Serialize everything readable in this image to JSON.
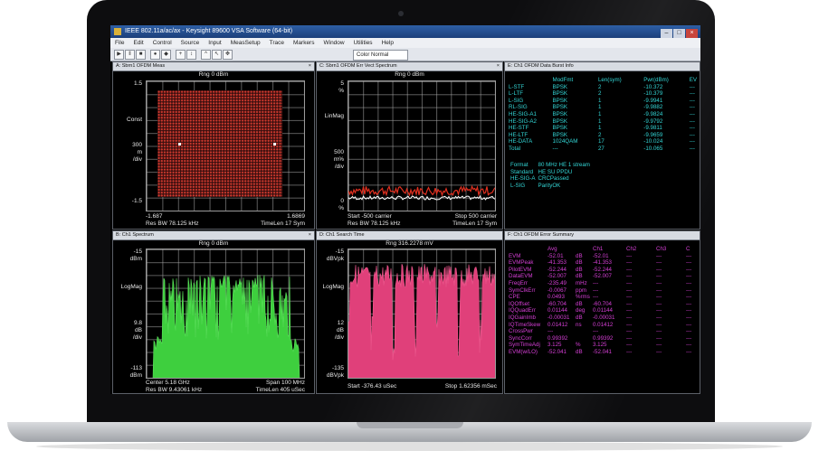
{
  "window": {
    "title": "IEEE 802.11a/ac/ax - Keysight 89600 VSA Software (64-bit)",
    "buttons": [
      "–",
      "□",
      "×"
    ]
  },
  "menu": [
    "File",
    "Edit",
    "Control",
    "Source",
    "Input",
    "MeasSetup",
    "Trace",
    "Markers",
    "Window",
    "Utilities",
    "Help"
  ],
  "toolbar": {
    "color_mode": "Color Normal",
    "icons": [
      "play-icon",
      "pause-icon",
      "stop-icon",
      "record-icon",
      "marker-icon",
      "zoom-icon",
      "cursor-icon",
      "pan-icon",
      "autoscale-icon",
      "peak-icon"
    ]
  },
  "colors": {
    "trace_white": "#ffffff",
    "trace_red": "#e03020",
    "trace_green": "#3ecf3e",
    "trace_pink": "#e0407a",
    "text_cyan": "#33d6d6",
    "text_magenta": "#d63fd6"
  },
  "panels": {
    "a": {
      "tab": "A: Sbrn1 OFDM Meas",
      "ref": "Rng 0 dBm",
      "y_labels": [
        "1.5",
        "Const",
        "300",
        "m",
        "/div",
        "-1.5"
      ],
      "footer_left": "-1.687",
      "footer_right": "1.6869",
      "footer2_left": "Res BW 78.125 kHz",
      "footer2_right": "TimeLen 17  Sym"
    },
    "b": {
      "tab": "B: Ch1 Spectrum",
      "ref": "Rng 0 dBm",
      "y_labels": [
        "-15",
        "dBm",
        "LogMag",
        "9.8",
        "dB",
        "/div",
        "-113",
        "dBm"
      ],
      "footer_left": "Center 5.18 GHz",
      "footer_right": "Span 100 MHz",
      "footer2_left": "Res BW 9.43061 kHz",
      "footer2_right": "TimeLen 405 uSec"
    },
    "c": {
      "tab": "C: Sbrn1 OFDM Err Vect Spectrum",
      "ref": "Rng 0 dBm",
      "y_labels": [
        "5",
        "%",
        "LinMag",
        "500",
        "m%",
        "/div",
        "0",
        "%"
      ],
      "footer_left": "Start -500  carrier",
      "footer_right": "Stop 500  carrier",
      "footer2_left": "Res BW 78.125 kHz",
      "footer2_right": "TimeLen 17  Sym"
    },
    "d": {
      "tab": "D: Ch1 Search Time",
      "ref": "Rng 316.2278 mV",
      "y_labels": [
        "-15",
        "dBVpk",
        "LogMag",
        "12",
        "dB",
        "/div",
        "-135",
        "dBVpk"
      ],
      "footer_left": "Start -376.43 uSec",
      "footer_right": "Stop 1.62356 mSec"
    },
    "e": {
      "tab": "E: Ch1 OFDM Data Burst Info",
      "headers": [
        "ModFmt",
        "Len(sym)",
        "Pwr(dBm)",
        "EV"
      ],
      "rows": [
        [
          "L-STF",
          "BPSK",
          "2",
          "-10.372",
          "---"
        ],
        [
          "L-LTF",
          "BPSK",
          "2",
          "-10.379",
          "---"
        ],
        [
          "L-SIG",
          "BPSK",
          "1",
          "-9.9941",
          "---"
        ],
        [
          "RL-SIG",
          "BPSK",
          "1",
          "-9.9882",
          "---"
        ],
        [
          "HE-SIG-A1",
          "BPSK",
          "1",
          "-9.9824",
          "---"
        ],
        [
          "HE-SIG-A2",
          "BPSK",
          "1",
          "-9.9792",
          "---"
        ],
        [
          "HE-STF",
          "BPSK",
          "1",
          "-9.9811",
          "---"
        ],
        [
          "HE-LTF",
          "BPSK",
          "2",
          "-9.9659",
          "---"
        ],
        [
          "HE-DATA",
          "1024QAM",
          "17",
          "-10.024",
          "---"
        ],
        [
          "Total",
          "---",
          "27",
          "-10.065",
          "---"
        ]
      ],
      "info": [
        [
          "Format",
          "80 MHz HE 1 stream"
        ],
        [
          "Standard",
          "HE SU PPDU"
        ],
        [
          "HE-SIG-A",
          "CRCPassed"
        ],
        [
          "L-SIG",
          "ParityOK"
        ]
      ]
    },
    "f": {
      "tab": "F: Ch1 OFDM Error Summary",
      "headers": [
        "",
        "Avg",
        "",
        "Ch1",
        "Ch2",
        "Ch3",
        "C"
      ],
      "rows": [
        [
          "EVM",
          "-52.01",
          "dB",
          "-52.01",
          "---",
          "---",
          "---"
        ],
        [
          "EVMPeak",
          "-41.353",
          "dB",
          "-41.353",
          "---",
          "---",
          "---"
        ],
        [
          "PilotEVM",
          "-52.244",
          "dB",
          "-52.244",
          "---",
          "---",
          "---"
        ],
        [
          "DataEVM",
          "-52.007",
          "dB",
          "-52.007",
          "---",
          "---",
          "---"
        ],
        [
          "",
          "",
          "",
          "",
          "",
          "",
          ""
        ],
        [
          "FreqErr",
          "-235.49",
          "mHz",
          "---",
          "---",
          "---",
          "---"
        ],
        [
          "SymClkErr",
          "-0.0067",
          "ppm",
          "---",
          "---",
          "---",
          "---"
        ],
        [
          "CPE",
          "0.0493",
          "%rms",
          "---",
          "---",
          "---",
          "---"
        ],
        [
          "",
          "",
          "",
          "",
          "",
          "",
          ""
        ],
        [
          "IQOffset",
          "-60.704",
          "dB",
          "-60.704",
          "---",
          "---",
          "---"
        ],
        [
          "IQQuadErr",
          "0.01144",
          "deg",
          "0.01144",
          "---",
          "---",
          "---"
        ],
        [
          "IQGainImb",
          "-0.00031",
          "dB",
          "-0.00031",
          "---",
          "---",
          "---"
        ],
        [
          "IQTimeSkew",
          "0.01412",
          "ns",
          "0.01412",
          "---",
          "---",
          "---"
        ],
        [
          "",
          "",
          "",
          "",
          "",
          "",
          ""
        ],
        [
          "CrossPwr",
          "---",
          "",
          "---",
          "---",
          "---",
          "---"
        ],
        [
          "SyncCorr",
          "0.99392",
          "",
          "0.99392",
          "---",
          "---",
          "---"
        ],
        [
          "SymTimeAdj",
          "3.125",
          "%",
          "3.125",
          "---",
          "---",
          "---"
        ],
        [
          "EVM(w/LO)",
          "-52.041",
          "dB",
          "-52.041",
          "---",
          "---",
          "---"
        ]
      ]
    }
  }
}
